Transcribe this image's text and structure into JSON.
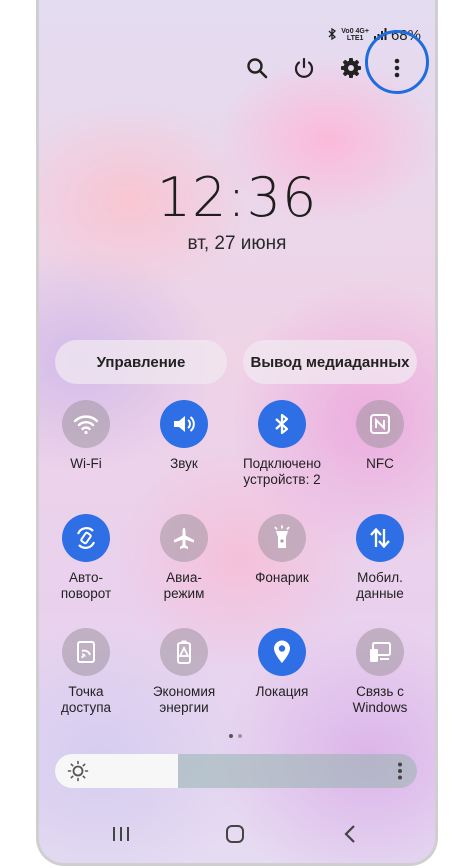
{
  "status_bar": {
    "network_top": "Vo0 4G+",
    "network_bottom": "LTE1",
    "battery": "68%"
  },
  "top_icons": [
    "search-icon",
    "power-icon",
    "settings-icon",
    "more-vertical-icon"
  ],
  "clock": {
    "time": "12:36",
    "date": "вт, 27 июня"
  },
  "buttons": {
    "device_control": "Управление",
    "media_output": "Вывод медиаданных"
  },
  "tiles": [
    {
      "label": "Wi-Fi",
      "icon": "wifi-icon",
      "state": "off"
    },
    {
      "label": "Звук",
      "icon": "sound-icon",
      "state": "on"
    },
    {
      "label": "Подключено\nустройств: 2",
      "icon": "bluetooth-icon",
      "state": "on"
    },
    {
      "label": "NFC",
      "icon": "nfc-icon",
      "state": "off"
    },
    {
      "label": "Авто-\nповорот",
      "icon": "auto-rotate-icon",
      "state": "on"
    },
    {
      "label": "Авиа-\nрежим",
      "icon": "airplane-icon",
      "state": "off"
    },
    {
      "label": "Фонарик",
      "icon": "flashlight-icon",
      "state": "off"
    },
    {
      "label": "Мобил.\nданные",
      "icon": "mobile-data-icon",
      "state": "on"
    },
    {
      "label": "Точка\nдоступа",
      "icon": "hotspot-icon",
      "state": "off"
    },
    {
      "label": "Экономия\nэнергии",
      "icon": "power-saving-icon",
      "state": "off"
    },
    {
      "label": "Локация",
      "icon": "location-icon",
      "state": "on"
    },
    {
      "label": "Связь с\nWindows",
      "icon": "link-to-windows-icon",
      "state": "off"
    }
  ],
  "page_indicator": {
    "current": 1,
    "total": 2
  },
  "brightness": {
    "level": 0.34
  },
  "colors": {
    "accent": "#2f6fe6",
    "highlight_ring": "#1d6ce0"
  }
}
